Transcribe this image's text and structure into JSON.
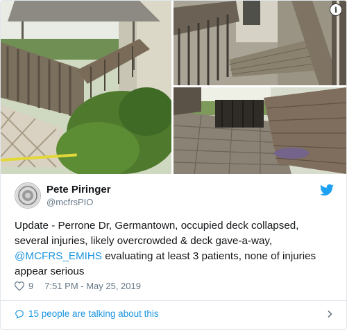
{
  "tweet": {
    "author_name": "Pete Piringer",
    "author_handle": "@mcfrsPIO",
    "text_parts": {
      "before": "Update - Perrone Dr, Germantown, occupied deck collapsed, several injuries, likely overcrowded & deck gave-a-way,",
      "mention": "@MCFRS_EMIHS",
      "after": "evaluating at least 3 patients, none of injuries appear serious"
    },
    "like_count": "9",
    "timestamp": "7:51 PM - May 25, 2019",
    "talking_about": "15 people are talking about this"
  },
  "media": {
    "info_glyph": "i",
    "photos": [
      "collapsed-deck-photo",
      "broken-stairs-photo",
      "deck-floor-photo"
    ]
  },
  "icons": {
    "heart": "heart-icon",
    "twitter": "twitter-bird-icon",
    "comment": "comment-bubble-icon",
    "chevron": "chevron-right-icon",
    "info": "info-icon"
  },
  "colors": {
    "link": "#1b95e0",
    "text": "#14171a",
    "secondary": "#657786",
    "border": "#e1e8ed"
  }
}
